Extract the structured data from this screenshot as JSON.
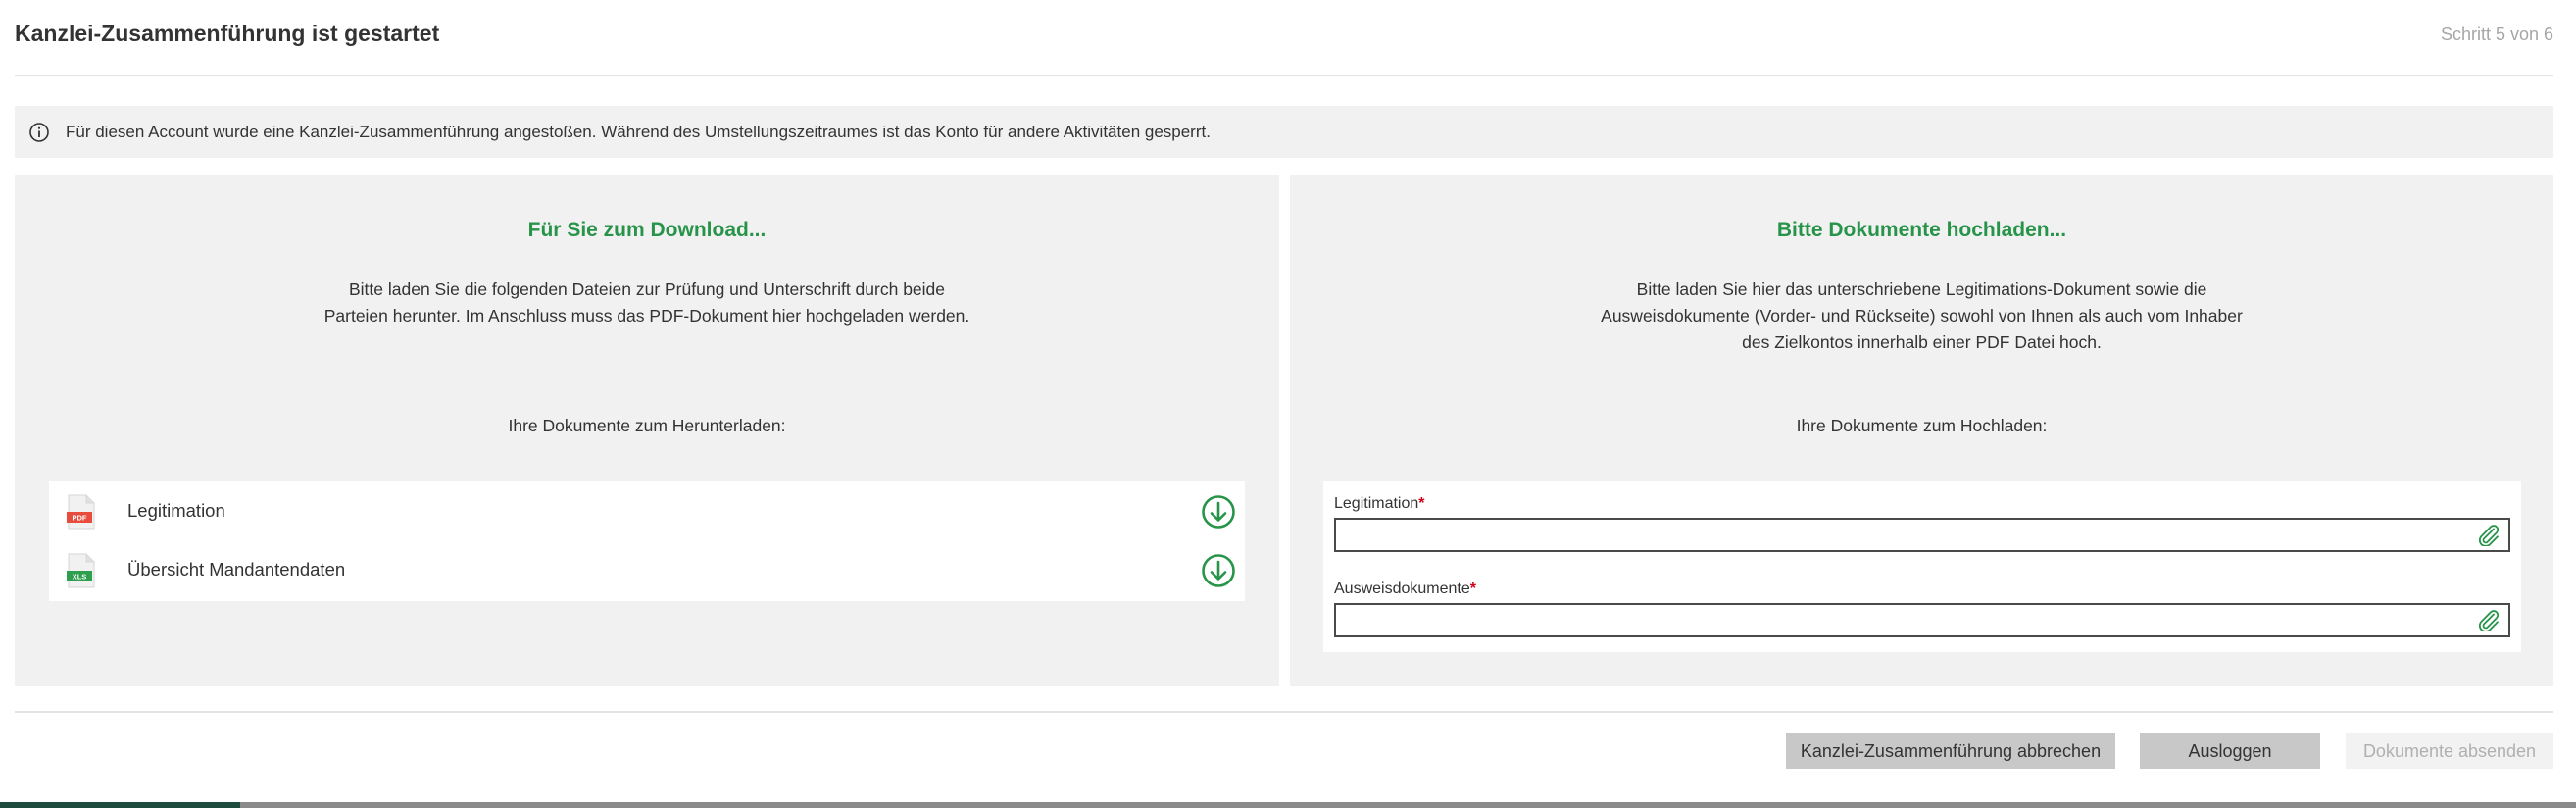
{
  "header": {
    "title": "Kanzlei-Zusammenführung ist gestartet",
    "step": "Schritt 5 von 6"
  },
  "info": {
    "icon": "info-circle-icon",
    "text": "Für diesen Account wurde eine Kanzlei-Zusammenführung angestoßen. Während des Umstellungszeitraumes ist das Konto für andere Aktivitäten gesperrt."
  },
  "download": {
    "heading": "Für Sie zum Download...",
    "text_line1": "Bitte laden Sie die folgenden Dateien zur Prüfung und Unterschrift durch beide",
    "text_line2": "Parteien herunter. Im Anschluss muss das PDF-Dokument hier hochgeladen werden.",
    "subheading": "Ihre Dokumente zum Herunterladen:",
    "items": [
      {
        "label": "Legitimation",
        "type_badge": "PDF",
        "icon": "pdf-file-icon"
      },
      {
        "label": "Übersicht Mandantendaten",
        "type_badge": "XLS",
        "icon": "xls-file-icon"
      }
    ]
  },
  "upload": {
    "heading": "Bitte Dokumente hochladen...",
    "text_line1": "Bitte laden Sie hier das unterschriebene Legitimations-Dokument sowie die",
    "text_line2": "Ausweisdokumente (Vorder- und Rückseite) sowohl von Ihnen als auch vom Inhaber",
    "text_line3": "des Zielkontos innerhalb einer PDF Datei hoch.",
    "subheading": "Ihre Dokumente zum Hochladen:",
    "fields": [
      {
        "label": "Legitimation",
        "required_mark": "*",
        "value": ""
      },
      {
        "label": "Ausweisdokumente",
        "required_mark": "*",
        "value": ""
      }
    ]
  },
  "actions": {
    "cancel": "Kanzlei-Zusammenführung abbrechen",
    "logout": "Ausloggen",
    "submit": "Dokumente absenden"
  },
  "colors": {
    "accent_green": "#27944a",
    "required_red": "#d0021b",
    "pdf_red": "#e84c3d",
    "xls_green": "#2e9e4f"
  }
}
